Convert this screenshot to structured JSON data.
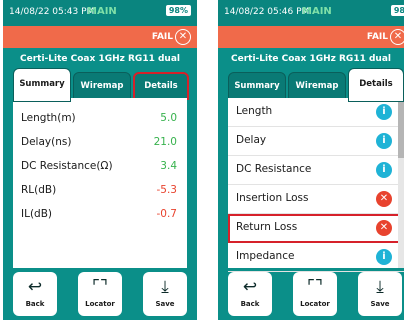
{
  "screen1": {
    "status": {
      "time": "14/08/22 05:43 PM",
      "mode": "MAIN",
      "battery": "98%"
    },
    "fail_text": "FAIL",
    "title": "Certi-Lite Coax 1GHz RG11 dual",
    "tabs": [
      "Summary",
      "Wiremap",
      "Details"
    ],
    "rows": [
      {
        "label": "Length(m)",
        "value": "5.0"
      },
      {
        "label": "Delay(ns)",
        "value": "21.0"
      },
      {
        "label": "DC Resistance(Ω)",
        "value": "3.4"
      },
      {
        "label": "RL(dB)",
        "value": "-5.3"
      },
      {
        "label": "IL(dB)",
        "value": "-0.7"
      }
    ],
    "buttons": [
      {
        "label": "Back",
        "icon": "back-arrow-icon"
      },
      {
        "label": "Locator",
        "icon": "locator-icon"
      },
      {
        "label": "Save",
        "icon": "save-download-icon"
      }
    ]
  },
  "screen2": {
    "status": {
      "time": "14/08/22 05:46 PM",
      "mode": "MAIN",
      "battery": "98"
    },
    "fail_text": "FAIL",
    "title": "Certi-Lite Coax 1GHz RG11 dual",
    "tabs": [
      "Summary",
      "Wiremap",
      "Details"
    ],
    "items": [
      {
        "label": "Length",
        "status": "info"
      },
      {
        "label": "Delay",
        "status": "info"
      },
      {
        "label": "DC Resistance",
        "status": "info"
      },
      {
        "label": "Insertion Loss",
        "status": "error"
      },
      {
        "label": "Return Loss",
        "status": "error"
      },
      {
        "label": "Impedance",
        "status": "info"
      }
    ],
    "buttons": [
      {
        "label": "Back",
        "icon": "back-arrow-icon"
      },
      {
        "label": "Locator",
        "icon": "locator-icon"
      },
      {
        "label": "Save",
        "icon": "save-download-icon"
      }
    ]
  },
  "colors": {
    "header": "#0b8f89",
    "fail": "#f06a4a",
    "pass_value": "#37b24d",
    "fail_value": "#e8432e",
    "highlight": "#d6212a"
  }
}
